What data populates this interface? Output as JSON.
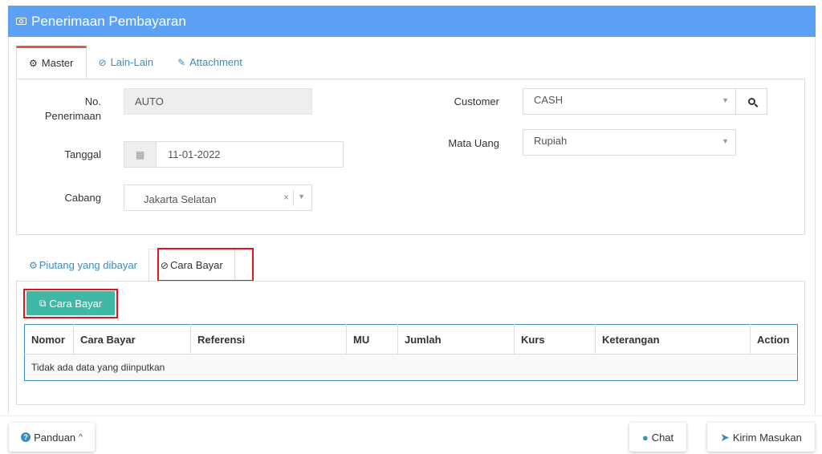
{
  "header": {
    "title": "Penerimaan Pembayaran",
    "icon": "money-icon"
  },
  "master_tabs": [
    {
      "label": "Master",
      "icon": "cogs-icon",
      "active": true
    },
    {
      "label": "Lain-Lain",
      "icon": "check-circle-icon",
      "active": false
    },
    {
      "label": "Attachment",
      "icon": "paperclip-icon",
      "active": false
    }
  ],
  "form": {
    "no_penerimaan": {
      "label_line1": "No.",
      "label_line2": "Penerimaan",
      "value": "AUTO"
    },
    "tanggal": {
      "label": "Tanggal",
      "value": "11-01-2022",
      "icon": "calendar-icon"
    },
    "cabang": {
      "label": "Cabang",
      "value": "Jakarta Selatan",
      "clear": "×"
    },
    "customer": {
      "label": "Customer",
      "value": "CASH",
      "search_icon": "search-icon"
    },
    "mata_uang": {
      "label": "Mata Uang",
      "value": "Rupiah"
    }
  },
  "detail_tabs": [
    {
      "label": "Piutang yang dibayar",
      "icon": "cogs-icon",
      "active": false
    },
    {
      "label": "Cara Bayar",
      "icon": "check-circle-icon",
      "active": true
    }
  ],
  "add_button": {
    "label": "Cara Bayar",
    "icon": "copy-icon"
  },
  "table": {
    "columns": [
      "Nomor",
      "Cara Bayar",
      "Referensi",
      "MU",
      "Jumlah",
      "Kurs",
      "Keterangan",
      "Action"
    ],
    "empty_text": "Tidak ada data yang diinputkan"
  },
  "footer": {
    "panduan": "Panduan",
    "chat": "Chat",
    "kirim": "Kirim Masukan"
  },
  "colors": {
    "header": "#5da1f5",
    "accent": "#3c8dbc",
    "teal": "#3fb8a6",
    "highlight": "#e0141a",
    "active_tab": "#e2574c"
  }
}
